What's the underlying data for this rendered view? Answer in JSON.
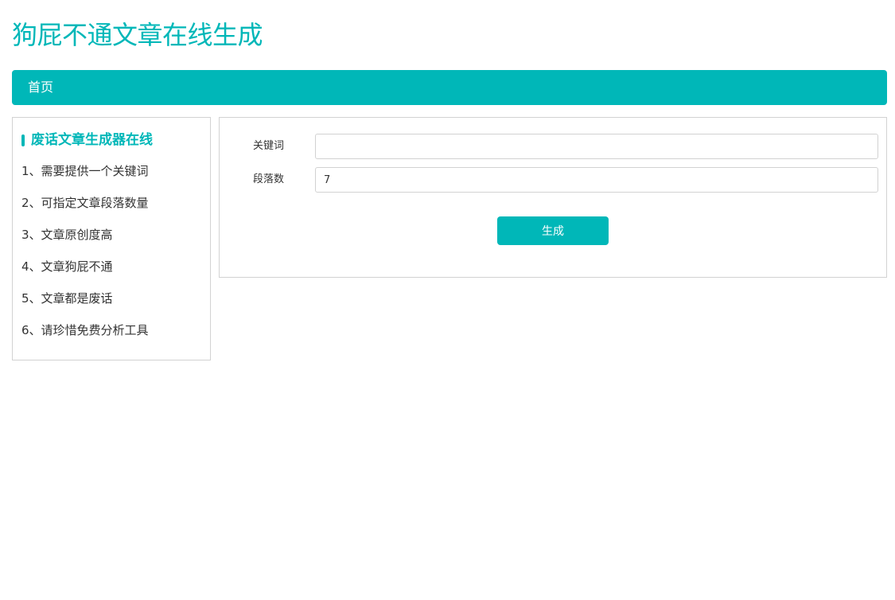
{
  "site": {
    "title": "狗屁不通文章在线生成"
  },
  "nav": {
    "items": [
      {
        "label": "首页"
      }
    ]
  },
  "sidebar": {
    "heading": "废话文章生成器在线",
    "items": [
      "1、需要提供一个关键词",
      "2、可指定文章段落数量",
      "3、文章原创度高",
      "4、文章狗屁不通",
      "5、文章都是废话",
      "6、请珍惜免费分析工具"
    ]
  },
  "form": {
    "keyword": {
      "label": "关键词",
      "value": ""
    },
    "paragraphs": {
      "label": "段落数",
      "value": "7"
    },
    "submit_label": "生成"
  },
  "colors": {
    "accent": "#00b7b8",
    "border": "#d2d2d2",
    "text": "#333333"
  }
}
